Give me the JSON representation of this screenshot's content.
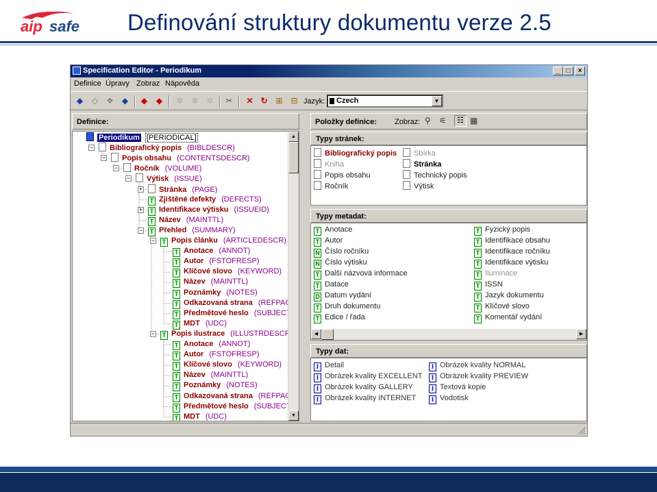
{
  "slide": {
    "title": "Definování struktury dokumentu verze 2.5",
    "logo_text": "aipsafe"
  },
  "window": {
    "title": "Specification Editor - Periodikum",
    "buttons": {
      "minimize": "_",
      "maximize": "□",
      "close": "×"
    }
  },
  "menu": [
    "Definice",
    "Úpravy",
    "Zobraz",
    "Nápověda"
  ],
  "toolbar": {
    "language_label": "Jazyk:",
    "language_value": "Czech"
  },
  "left_pane": {
    "header": "Definice:"
  },
  "tree": [
    {
      "name": "Periodikum",
      "code": "[PERIODICAL]",
      "level": 0,
      "icon": "book",
      "selected": true,
      "expander": ""
    },
    {
      "name": "Bibliografický popis",
      "code": "(BIBLDESCR)",
      "level": 1,
      "icon": "page",
      "expander": "-"
    },
    {
      "name": "Popis obsahu",
      "code": "(CONTENTSDESCR)",
      "level": 2,
      "icon": "page",
      "expander": "-"
    },
    {
      "name": "Ročník",
      "code": "(VOLUME)",
      "level": 3,
      "icon": "page",
      "expander": "-"
    },
    {
      "name": "Výtisk",
      "code": "(ISSUE)",
      "level": 4,
      "icon": "page",
      "expander": "-"
    },
    {
      "name": "Stránka",
      "code": "(PAGE)",
      "level": 5,
      "icon": "page",
      "expander": "+"
    },
    {
      "name": "Zjištěné defekty",
      "code": "(DEFECTS)",
      "level": 5,
      "icon": "T",
      "expander": ""
    },
    {
      "name": "Identifikace výtisku",
      "code": "(ISSUEID)",
      "level": 5,
      "icon": "T",
      "expander": "+"
    },
    {
      "name": "Název",
      "code": "(MAINTTL)",
      "level": 5,
      "icon": "T",
      "expander": ""
    },
    {
      "name": "Přehled",
      "code": "(SUMMARY)",
      "level": 5,
      "icon": "T",
      "expander": "-"
    },
    {
      "name": "Popis článku",
      "code": "(ARTICLEDESCR)",
      "level": 6,
      "icon": "T",
      "expander": "-"
    },
    {
      "name": "Anotace",
      "code": "(ANNOT)",
      "level": 7,
      "icon": "T",
      "expander": ""
    },
    {
      "name": "Autor",
      "code": "(FSTOFRESP)",
      "level": 7,
      "icon": "T",
      "expander": ""
    },
    {
      "name": "Klíčové slovo",
      "code": "(KEYWORD)",
      "level": 7,
      "icon": "T",
      "expander": ""
    },
    {
      "name": "Název",
      "code": "(MAINTTL)",
      "level": 7,
      "icon": "T",
      "expander": ""
    },
    {
      "name": "Poznámky",
      "code": "(NOTES)",
      "level": 7,
      "icon": "T",
      "expander": ""
    },
    {
      "name": "Odkazovaná strana",
      "code": "(REFPAGE)",
      "level": 7,
      "icon": "T",
      "expander": ""
    },
    {
      "name": "Předmětové heslo",
      "code": "(SUBJECT)",
      "level": 7,
      "icon": "T",
      "expander": ""
    },
    {
      "name": "MDT",
      "code": "(UDC)",
      "level": 7,
      "icon": "T",
      "expander": ""
    },
    {
      "name": "Popis ilustrace",
      "code": "(ILLUSTRDESCR)",
      "level": 6,
      "icon": "T",
      "expander": "-"
    },
    {
      "name": "Anotace",
      "code": "(ANNOT)",
      "level": 7,
      "icon": "T",
      "expander": ""
    },
    {
      "name": "Autor",
      "code": "(FSTOFRESP)",
      "level": 7,
      "icon": "T",
      "expander": ""
    },
    {
      "name": "Klíčové slovo",
      "code": "(KEYWORD)",
      "level": 7,
      "icon": "T",
      "expander": ""
    },
    {
      "name": "Název",
      "code": "(MAINTTL)",
      "level": 7,
      "icon": "T",
      "expander": ""
    },
    {
      "name": "Poznámky",
      "code": "(NOTES)",
      "level": 7,
      "icon": "T",
      "expander": ""
    },
    {
      "name": "Odkazovaná strana",
      "code": "(REFPAGE)",
      "level": 7,
      "icon": "T",
      "expander": ""
    },
    {
      "name": "Předmětové heslo",
      "code": "(SUBJECT)",
      "level": 7,
      "icon": "T",
      "expander": ""
    },
    {
      "name": "MDT",
      "code": "(UDC)",
      "level": 7,
      "icon": "T",
      "expander": ""
    }
  ],
  "right_pane": {
    "header": "Položky definice:",
    "view_label": "Zobraz:"
  },
  "page_types": {
    "header": "Typy stránek:",
    "col1": [
      {
        "label": "Bibliografický popis",
        "style": "red"
      },
      {
        "label": "Kniha",
        "style": "dim"
      },
      {
        "label": "Popis obsahu",
        "style": "blk"
      },
      {
        "label": "Ročník",
        "style": "blk"
      }
    ],
    "col2": [
      {
        "label": "Sbírka",
        "style": "dim"
      },
      {
        "label": "Stránka",
        "style": "strong"
      },
      {
        "label": "Technický popis",
        "style": "blk"
      },
      {
        "label": "Výtisk",
        "style": "blk"
      }
    ]
  },
  "metadata_types": {
    "header": "Typy metadat:",
    "col1": [
      {
        "label": "Anotace",
        "icon": "T",
        "style": "blk"
      },
      {
        "label": "Autor",
        "icon": "T",
        "style": "blk"
      },
      {
        "label": "Číslo ročníku",
        "icon": "N",
        "style": "blk"
      },
      {
        "label": "Číslo výtisku",
        "icon": "N",
        "style": "blk"
      },
      {
        "label": "Další názvová informace",
        "icon": "T",
        "style": "blk"
      },
      {
        "label": "Datace",
        "icon": "T",
        "style": "blk"
      },
      {
        "label": "Datum vydání",
        "icon": "D",
        "style": "blk"
      },
      {
        "label": "Druh dokumentu",
        "icon": "T",
        "style": "blk"
      },
      {
        "label": "Edice / řada",
        "icon": "T",
        "style": "blk"
      }
    ],
    "col2": [
      {
        "label": "Fyzický popis",
        "icon": "T",
        "style": "blk"
      },
      {
        "label": "Identifikace obsahu",
        "icon": "T",
        "style": "blk"
      },
      {
        "label": "Identifikace ročníku",
        "icon": "T",
        "style": "blk"
      },
      {
        "label": "Identifikace výtisku",
        "icon": "T",
        "style": "blk"
      },
      {
        "label": "Iluminace",
        "icon": "T",
        "style": "dim"
      },
      {
        "label": "ISSN",
        "icon": "T",
        "style": "blk"
      },
      {
        "label": "Jazyk dokumentu",
        "icon": "T",
        "style": "blk"
      },
      {
        "label": "Klíčové slovo",
        "icon": "T",
        "style": "blk"
      },
      {
        "label": "Komentář vydání",
        "icon": "T",
        "style": "blk"
      }
    ]
  },
  "data_types": {
    "header": "Typy dat:",
    "col1": [
      {
        "label": "Detail",
        "icon": "I"
      },
      {
        "label": "Obrázek kvality EXCELLENT",
        "icon": "I"
      },
      {
        "label": "Obrázek kvality GALLERY",
        "icon": "I"
      },
      {
        "label": "Obrázek kvality INTERNET",
        "icon": "I"
      }
    ],
    "col2": [
      {
        "label": "Obrázek kvality NORMAL",
        "icon": "I"
      },
      {
        "label": "Obrázek kvality PREVIEW",
        "icon": "I"
      },
      {
        "label": "Textová kopie",
        "icon": "I"
      },
      {
        "label": "Vodotisk",
        "icon": "I"
      }
    ]
  },
  "colors": {
    "title": "#0b2a6b",
    "titlebar": "#0a246a",
    "tree_name": "#8b0000",
    "tree_code": "#8b008b",
    "icon_green": "#008000",
    "icon_blue": "#00008b"
  }
}
